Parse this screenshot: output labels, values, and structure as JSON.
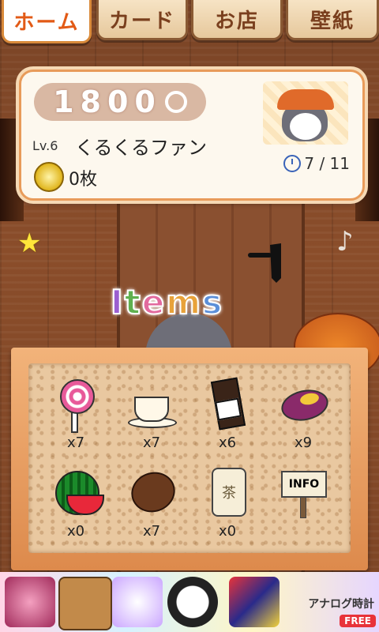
{
  "tabs": [
    {
      "label": "ホーム",
      "active": true
    },
    {
      "label": "カード",
      "active": false
    },
    {
      "label": "お店",
      "active": false
    },
    {
      "label": "壁紙",
      "active": false
    }
  ],
  "status": {
    "points": "1800",
    "level": "Lv.6",
    "title": "くるくるファン",
    "medals": "0枚",
    "progress": "7 / 11"
  },
  "items_title": [
    "I",
    "t",
    "e",
    "m",
    "s"
  ],
  "items": [
    {
      "icon": "lollipop-icon",
      "count": "x7"
    },
    {
      "icon": "coffee-cup-icon",
      "count": "x7"
    },
    {
      "icon": "chocolate-icon",
      "count": "x6"
    },
    {
      "icon": "sweet-potato-icon",
      "count": "x9"
    },
    {
      "icon": "watermelon-icon",
      "count": "x0"
    },
    {
      "icon": "coffee-bean-icon",
      "count": "x7"
    },
    {
      "icon": "tea-can-icon",
      "count": "x0",
      "label": "茶"
    },
    {
      "icon": "info-sign-icon",
      "count": "",
      "label": "INFO"
    }
  ],
  "banner": {
    "analog_label": "アナログ時計",
    "free_badge": "FREE"
  }
}
